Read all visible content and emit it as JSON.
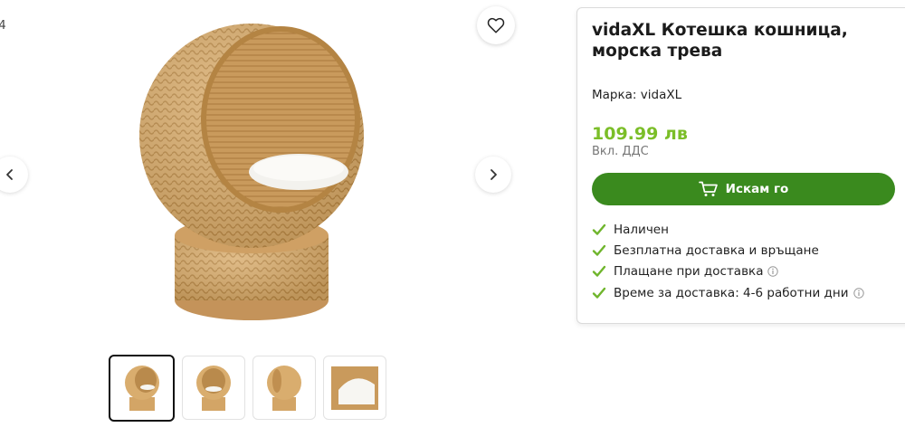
{
  "gallery": {
    "counter": "/4",
    "favorite_icon": "heart-icon",
    "prev_icon": "chevron-left-icon",
    "next_icon": "chevron-right-icon",
    "thumbnails": [
      "thumb-1",
      "thumb-2",
      "thumb-3",
      "thumb-4"
    ]
  },
  "product": {
    "title": "vidaXL Котешка кошница, морска трева",
    "brand": "Марка: vidaXL",
    "price": "109.99 лв",
    "vat_note": "Вкл. ДДС",
    "buy_label": "Искам го",
    "features": [
      {
        "label": "Наличен",
        "info": false
      },
      {
        "label": "Безплатна доставка и връщане",
        "info": false
      },
      {
        "label": "Плащане при доставка",
        "info": true
      },
      {
        "label": "Време за доставка: 4-6 работни дни",
        "info": true
      }
    ]
  },
  "colors": {
    "price": "#7bbe28",
    "button": "#3a8a1e",
    "check": "#6fb52c"
  }
}
